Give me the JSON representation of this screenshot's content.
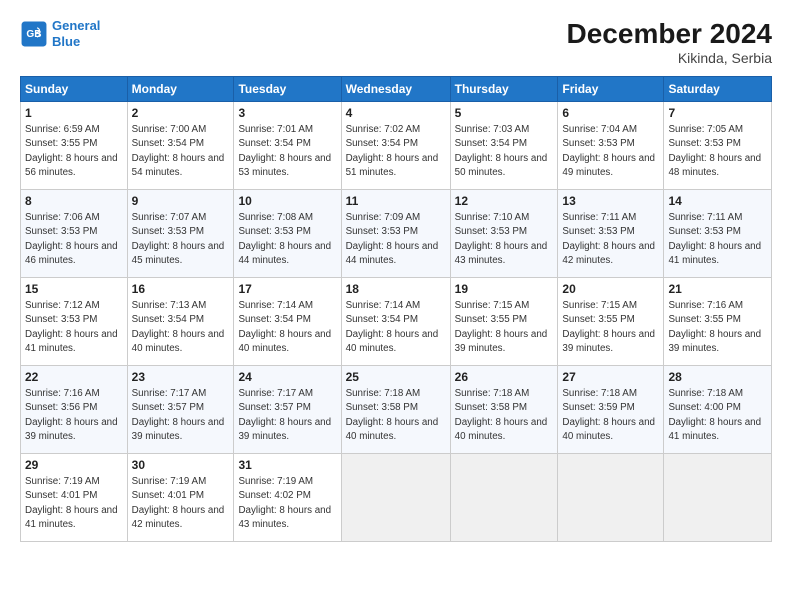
{
  "header": {
    "logo_line1": "General",
    "logo_line2": "Blue",
    "month_title": "December 2024",
    "subtitle": "Kikinda, Serbia"
  },
  "days_of_week": [
    "Sunday",
    "Monday",
    "Tuesday",
    "Wednesday",
    "Thursday",
    "Friday",
    "Saturday"
  ],
  "weeks": [
    [
      {
        "num": "1",
        "sunrise": "Sunrise: 6:59 AM",
        "sunset": "Sunset: 3:55 PM",
        "daylight": "Daylight: 8 hours and 56 minutes."
      },
      {
        "num": "2",
        "sunrise": "Sunrise: 7:00 AM",
        "sunset": "Sunset: 3:54 PM",
        "daylight": "Daylight: 8 hours and 54 minutes."
      },
      {
        "num": "3",
        "sunrise": "Sunrise: 7:01 AM",
        "sunset": "Sunset: 3:54 PM",
        "daylight": "Daylight: 8 hours and 53 minutes."
      },
      {
        "num": "4",
        "sunrise": "Sunrise: 7:02 AM",
        "sunset": "Sunset: 3:54 PM",
        "daylight": "Daylight: 8 hours and 51 minutes."
      },
      {
        "num": "5",
        "sunrise": "Sunrise: 7:03 AM",
        "sunset": "Sunset: 3:54 PM",
        "daylight": "Daylight: 8 hours and 50 minutes."
      },
      {
        "num": "6",
        "sunrise": "Sunrise: 7:04 AM",
        "sunset": "Sunset: 3:53 PM",
        "daylight": "Daylight: 8 hours and 49 minutes."
      },
      {
        "num": "7",
        "sunrise": "Sunrise: 7:05 AM",
        "sunset": "Sunset: 3:53 PM",
        "daylight": "Daylight: 8 hours and 48 minutes."
      }
    ],
    [
      {
        "num": "8",
        "sunrise": "Sunrise: 7:06 AM",
        "sunset": "Sunset: 3:53 PM",
        "daylight": "Daylight: 8 hours and 46 minutes."
      },
      {
        "num": "9",
        "sunrise": "Sunrise: 7:07 AM",
        "sunset": "Sunset: 3:53 PM",
        "daylight": "Daylight: 8 hours and 45 minutes."
      },
      {
        "num": "10",
        "sunrise": "Sunrise: 7:08 AM",
        "sunset": "Sunset: 3:53 PM",
        "daylight": "Daylight: 8 hours and 44 minutes."
      },
      {
        "num": "11",
        "sunrise": "Sunrise: 7:09 AM",
        "sunset": "Sunset: 3:53 PM",
        "daylight": "Daylight: 8 hours and 44 minutes."
      },
      {
        "num": "12",
        "sunrise": "Sunrise: 7:10 AM",
        "sunset": "Sunset: 3:53 PM",
        "daylight": "Daylight: 8 hours and 43 minutes."
      },
      {
        "num": "13",
        "sunrise": "Sunrise: 7:11 AM",
        "sunset": "Sunset: 3:53 PM",
        "daylight": "Daylight: 8 hours and 42 minutes."
      },
      {
        "num": "14",
        "sunrise": "Sunrise: 7:11 AM",
        "sunset": "Sunset: 3:53 PM",
        "daylight": "Daylight: 8 hours and 41 minutes."
      }
    ],
    [
      {
        "num": "15",
        "sunrise": "Sunrise: 7:12 AM",
        "sunset": "Sunset: 3:53 PM",
        "daylight": "Daylight: 8 hours and 41 minutes."
      },
      {
        "num": "16",
        "sunrise": "Sunrise: 7:13 AM",
        "sunset": "Sunset: 3:54 PM",
        "daylight": "Daylight: 8 hours and 40 minutes."
      },
      {
        "num": "17",
        "sunrise": "Sunrise: 7:14 AM",
        "sunset": "Sunset: 3:54 PM",
        "daylight": "Daylight: 8 hours and 40 minutes."
      },
      {
        "num": "18",
        "sunrise": "Sunrise: 7:14 AM",
        "sunset": "Sunset: 3:54 PM",
        "daylight": "Daylight: 8 hours and 40 minutes."
      },
      {
        "num": "19",
        "sunrise": "Sunrise: 7:15 AM",
        "sunset": "Sunset: 3:55 PM",
        "daylight": "Daylight: 8 hours and 39 minutes."
      },
      {
        "num": "20",
        "sunrise": "Sunrise: 7:15 AM",
        "sunset": "Sunset: 3:55 PM",
        "daylight": "Daylight: 8 hours and 39 minutes."
      },
      {
        "num": "21",
        "sunrise": "Sunrise: 7:16 AM",
        "sunset": "Sunset: 3:55 PM",
        "daylight": "Daylight: 8 hours and 39 minutes."
      }
    ],
    [
      {
        "num": "22",
        "sunrise": "Sunrise: 7:16 AM",
        "sunset": "Sunset: 3:56 PM",
        "daylight": "Daylight: 8 hours and 39 minutes."
      },
      {
        "num": "23",
        "sunrise": "Sunrise: 7:17 AM",
        "sunset": "Sunset: 3:57 PM",
        "daylight": "Daylight: 8 hours and 39 minutes."
      },
      {
        "num": "24",
        "sunrise": "Sunrise: 7:17 AM",
        "sunset": "Sunset: 3:57 PM",
        "daylight": "Daylight: 8 hours and 39 minutes."
      },
      {
        "num": "25",
        "sunrise": "Sunrise: 7:18 AM",
        "sunset": "Sunset: 3:58 PM",
        "daylight": "Daylight: 8 hours and 40 minutes."
      },
      {
        "num": "26",
        "sunrise": "Sunrise: 7:18 AM",
        "sunset": "Sunset: 3:58 PM",
        "daylight": "Daylight: 8 hours and 40 minutes."
      },
      {
        "num": "27",
        "sunrise": "Sunrise: 7:18 AM",
        "sunset": "Sunset: 3:59 PM",
        "daylight": "Daylight: 8 hours and 40 minutes."
      },
      {
        "num": "28",
        "sunrise": "Sunrise: 7:18 AM",
        "sunset": "Sunset: 4:00 PM",
        "daylight": "Daylight: 8 hours and 41 minutes."
      }
    ],
    [
      {
        "num": "29",
        "sunrise": "Sunrise: 7:19 AM",
        "sunset": "Sunset: 4:01 PM",
        "daylight": "Daylight: 8 hours and 41 minutes."
      },
      {
        "num": "30",
        "sunrise": "Sunrise: 7:19 AM",
        "sunset": "Sunset: 4:01 PM",
        "daylight": "Daylight: 8 hours and 42 minutes."
      },
      {
        "num": "31",
        "sunrise": "Sunrise: 7:19 AM",
        "sunset": "Sunset: 4:02 PM",
        "daylight": "Daylight: 8 hours and 43 minutes."
      },
      null,
      null,
      null,
      null
    ]
  ]
}
